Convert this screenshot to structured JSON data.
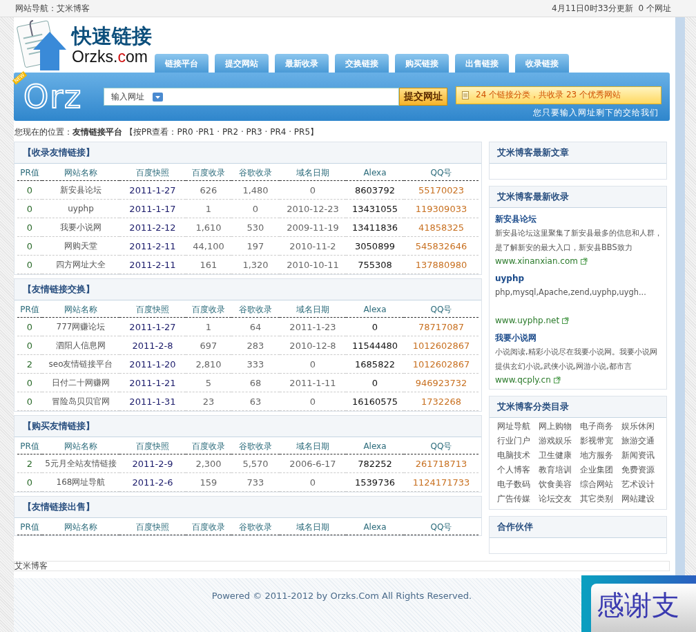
{
  "top_bar": {
    "left": "网站导航：艾米博客",
    "right": "4月11日0时33分更新  0 个网址"
  },
  "logo": {
    "title": "快速链接",
    "domain_prefix": "Orzks.",
    "domain_accent": "c",
    "domain_suffix": "om"
  },
  "nav_tabs": [
    "链接平台",
    "提交网站",
    "最新收录",
    "交换链接",
    "购买链接",
    "出售链接",
    "收录链接"
  ],
  "banner": {
    "badge": "NEW",
    "brand": "Orz",
    "dropdown": "输入网址",
    "submit": "提交网址",
    "stats": "24 个链接分类，共收录 23 个优秀网站",
    "slogan": "您只要输入网址剩下的交给我们"
  },
  "breadcrumb": "您现在的位置：**友情链接平台** 【按PR查看：PR0 ·PR1 · PR2 · PR3 · PR4 · PR5】",
  "sections": [
    {
      "title": "【收录友情链接】",
      "columns": [
        "PR值",
        "网站名称",
        "百度快照",
        "百度收录",
        "谷歌收录",
        "域名日期",
        "Alexa",
        "QQ号"
      ],
      "rows": [
        [
          "0",
          "新安县论坛",
          "2011-1-27",
          "626",
          "1,480",
          "0",
          "8603792",
          "55170023"
        ],
        [
          "0",
          "uyphp",
          "2011-1-17",
          "1",
          "0",
          "2010-12-23",
          "13431055",
          "119309033"
        ],
        [
          "0",
          "我要小说网",
          "2011-2-12",
          "1,610",
          "530",
          "2009-11-19",
          "13411836",
          "41858325"
        ],
        [
          "0",
          "网购天堂",
          "2011-2-11",
          "44,100",
          "197",
          "2010-11-2",
          "3050899",
          "545832646"
        ],
        [
          "0",
          "四方网址大全",
          "2011-2-11",
          "161",
          "1,320",
          "2010-10-11",
          "755308",
          "137880980"
        ]
      ]
    },
    {
      "title": "【友情链接交换】",
      "columns": [
        "PR值",
        "网站名称",
        "百度快照",
        "百度收录",
        "谷歌收录",
        "域名日期",
        "Alexa",
        "QQ号"
      ],
      "rows": [
        [
          "0",
          "777网赚论坛",
          "2011-1-27",
          "1",
          "64",
          "2011-1-23",
          "0",
          "78717087"
        ],
        [
          "0",
          "泗阳人信息网",
          "2011-2-8",
          "697",
          "283",
          "2010-12-8",
          "11544480",
          "1012602867"
        ],
        [
          "2",
          "seo友情链接平台",
          "2011-1-20",
          "2,810",
          "333",
          "0",
          "1685822",
          "1012602867"
        ],
        [
          "0",
          "日付二十网赚网",
          "2011-1-21",
          "5",
          "68",
          "2011-1-11",
          "0",
          "946923732"
        ],
        [
          "0",
          "冒险岛贝贝官网",
          "2011-1-31",
          "23",
          "63",
          "0",
          "16160575",
          "1732268"
        ]
      ]
    },
    {
      "title": "【购买友情链接】",
      "columns": [
        "PR值",
        "网站名称",
        "百度快照",
        "百度收录",
        "谷歌收录",
        "域名日期",
        "Alexa",
        "QQ号"
      ],
      "rows": [
        [
          "2",
          "5元月全站友情链接",
          "2011-2-9",
          "2,300",
          "5,570",
          "2006-6-17",
          "782252",
          "261718713"
        ],
        [
          "0",
          "168网址导航",
          "2011-2-6",
          "159",
          "733",
          "0",
          "1539736",
          "1124171733"
        ]
      ]
    },
    {
      "title": "【友情链接出售】",
      "columns": [
        "PR值",
        "网站名称",
        "百度快照",
        "百度收录",
        "谷歌收录",
        "域名日期",
        "Alexa",
        "QQ号"
      ]
    }
  ],
  "sidebar": [
    {
      "kind": "empty",
      "title": "艾米博客最新文章"
    },
    {
      "kind": "entries",
      "title": "艾米博客最新收录",
      "entries": [
        {
          "name": "新安县论坛",
          "desc": "新安县论坛这里聚集了新安县最多的信息和人群，是了解新安的最大入口，新安县BBS致力",
          "url": "www.xinanxian.com"
        },
        {
          "name": "uyphp",
          "desc": "php,mysql,Apache,zend,uyphp,uygh...",
          "url": "www.uyphp.net"
        },
        {
          "name": "我要小说网",
          "desc": "小说阅读,精彩小说尽在我要小说网。我要小说网提供玄幻小说,武侠小说,网游小说,都市言",
          "url": "www.qcply.cn"
        }
      ]
    },
    {
      "kind": "categories",
      "title": "艾米博客分类目录",
      "items": [
        "网址导航",
        "网上购物",
        "电子商务",
        "娱乐休闲",
        "行业门户",
        "游戏娱乐",
        "影视带宽",
        "旅游交通",
        "电脑技术",
        "卫生健康",
        "地方服务",
        "新闻资讯",
        "个人博客",
        "教育培训",
        "企业集团",
        "免费资源",
        "电子数码",
        "饮食美容",
        "综合网站",
        "艺术设计",
        "广告传媒",
        "论坛交友",
        "其它类别",
        "网站建设"
      ]
    },
    {
      "kind": "empty",
      "title": "合作伙伴"
    }
  ],
  "footer": {
    "site": "艾米博客",
    "copyright": "Powered © 2011-2012 by Orzks.Com All Rights Reserved.",
    "thanks": "感谢支"
  }
}
